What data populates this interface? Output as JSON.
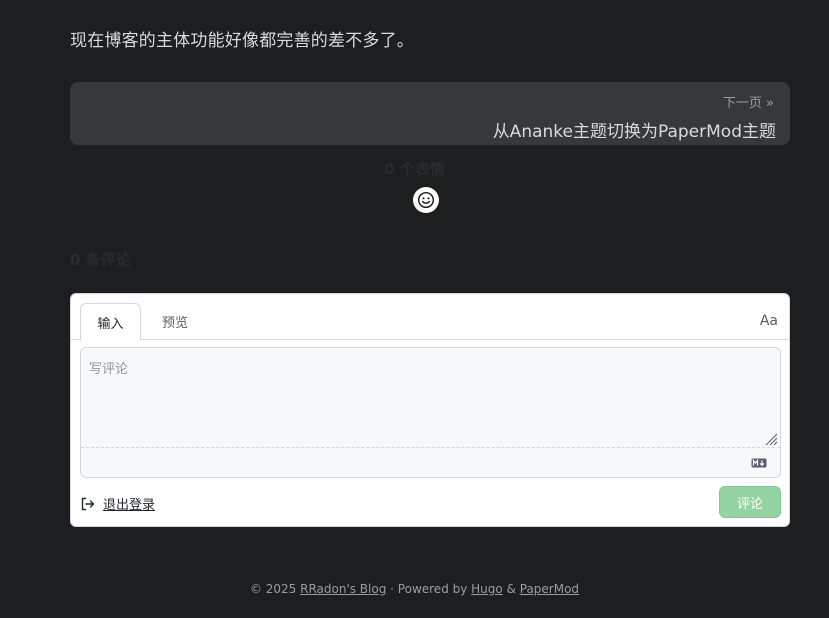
{
  "post": {
    "closing_text": "现在博客的主体功能好像都完善的差不多了。"
  },
  "pagination": {
    "next_hint": "下一页 »",
    "next_title": "从Ananke主题切换为PaperMod主题"
  },
  "comments": {
    "reactions_count": "0 个表情",
    "comments_count": "0 条评论",
    "tabs": [
      {
        "label": "输入",
        "active": true
      },
      {
        "label": "预览",
        "active": false
      }
    ],
    "format_toggle_label": "Aa",
    "textarea_placeholder": "写评论",
    "logout_label": "退出登录",
    "submit_label": "评论",
    "icons": {
      "emoji": "smiley-icon",
      "markdown": "markdown-icon",
      "logout": "sign-out-icon",
      "resize": "resize-grip-icon"
    },
    "colors": {
      "submit_bg": "#94d3a2",
      "card_bg": "#37383c",
      "page_bg": "#1d1e20"
    }
  },
  "footer": {
    "copyright": "© 2025 ",
    "blog_name": "RRadon's Blog",
    "powered_by": " · Powered by ",
    "hugo": "Hugo",
    "amp": " & ",
    "papermod": "PaperMod"
  }
}
